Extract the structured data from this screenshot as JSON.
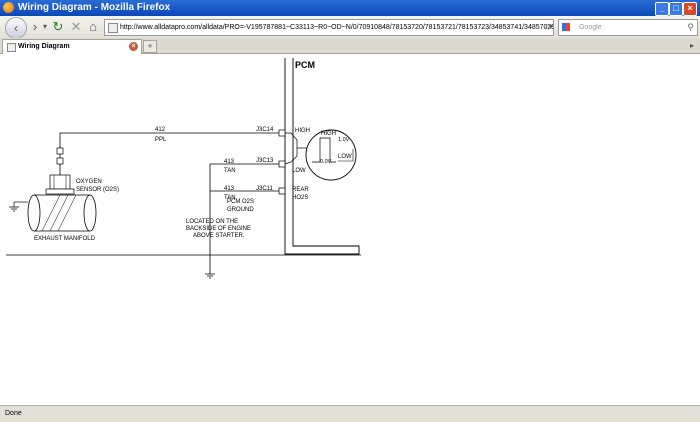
{
  "window": {
    "title": "Wiring Diagram - Mozilla Firefox"
  },
  "toolbar": {
    "url": "http://www.alldatapro.com/alldata/PRO=-V195787881~C33113~R0~OD~N/0/70910848/78153720/78153721/78153723/34853741/34857029/34857030/3",
    "search_placeholder": "Google"
  },
  "tab": {
    "title": "Wiring Diagram"
  },
  "status": {
    "text": "Done"
  },
  "diagram": {
    "pcm_title": "PCM",
    "wire1_num": "412",
    "wire1_color": "PPL",
    "pin1": "J3C14",
    "pin1_label": "HIGH",
    "wire2_num": "413",
    "wire2_color": "TAN",
    "pin2": "J3C13",
    "pin2_label": "LOW",
    "wire3_num": "413",
    "wire3_color": "TAN",
    "pin3": "J3C11",
    "pin3_label1": "REAR",
    "pin3_label2": "HO2S",
    "graph_high": "HIGH",
    "graph_low": "LOW",
    "graph_v1": "1.0V",
    "graph_v0": "0.0V",
    "sensor_label1": "OXYGEN",
    "sensor_label2": "SENSOR (O2S)",
    "manifold_label": "EXHAUST MANIFOLD",
    "ground_label1": "PCM O2S",
    "ground_label2": "GROUND",
    "location1": "LOCATED ON THE",
    "location2": "BACKSIDE OF ENGINE",
    "location3": "ABOVE STARTER."
  }
}
